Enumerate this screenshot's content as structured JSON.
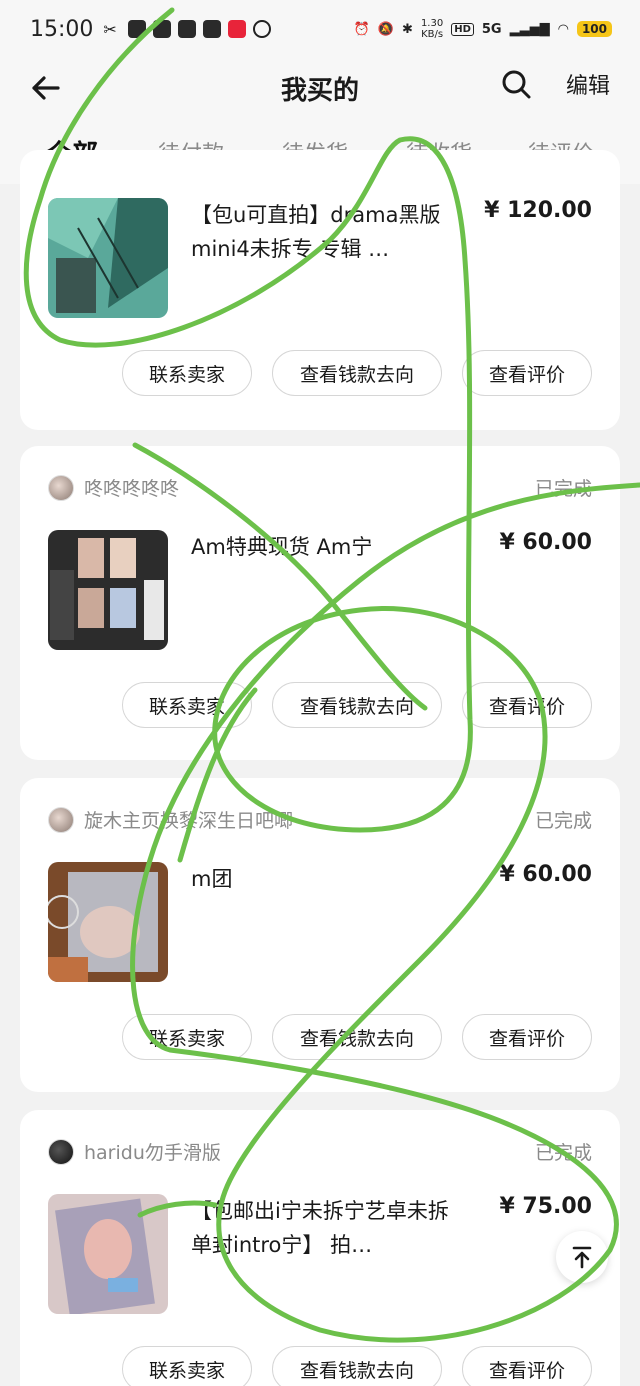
{
  "status_bar": {
    "time": "15:00",
    "net_speed_value": "1.30",
    "net_speed_unit": "KB/s",
    "hd": "HD",
    "network": "5G",
    "battery": "100"
  },
  "header": {
    "title": "我买的",
    "edit_label": "编辑"
  },
  "tabs": [
    "全部",
    "待付款",
    "待发货",
    "待收货",
    "待评价"
  ],
  "active_tab": "全部",
  "orders": [
    {
      "shop_name": "",
      "status": "",
      "title": "【包u可直拍】drama黑版 mini4未拆专 专辑 …",
      "price": "¥ 120.00",
      "buttons": {
        "contact": "联系卖家",
        "money": "查看钱款去向",
        "review": "查看评价"
      }
    },
    {
      "shop_name": "咚咚咚咚咚",
      "status": "已完成",
      "title": "Am特典现货 Am宁",
      "price": "¥ 60.00",
      "buttons": {
        "contact": "联系卖家",
        "money": "查看钱款去向",
        "review": "查看评价"
      }
    },
    {
      "shop_name": "旋木主页换黎深生日吧唧",
      "status": "已完成",
      "title": "m团",
      "price": "¥ 60.00",
      "buttons": {
        "contact": "联系卖家",
        "money": "查看钱款去向",
        "review": "查看评价"
      }
    },
    {
      "shop_name": "haridu勿手滑版",
      "status": "已完成",
      "title": "【包邮出i宁未拆宁艺卓未拆单封intro宁】 拍…",
      "price": "¥ 75.00",
      "buttons": {
        "contact": "联系卖家",
        "money": "查看钱款去向",
        "review": "查看评价"
      }
    }
  ],
  "colors": {
    "tab_indicator": "#ff3a3a",
    "scribble": "#6cc04a",
    "battery": "#f5c518"
  },
  "icons": [
    "back-arrow-icon",
    "search-icon",
    "back-to-top-icon"
  ]
}
